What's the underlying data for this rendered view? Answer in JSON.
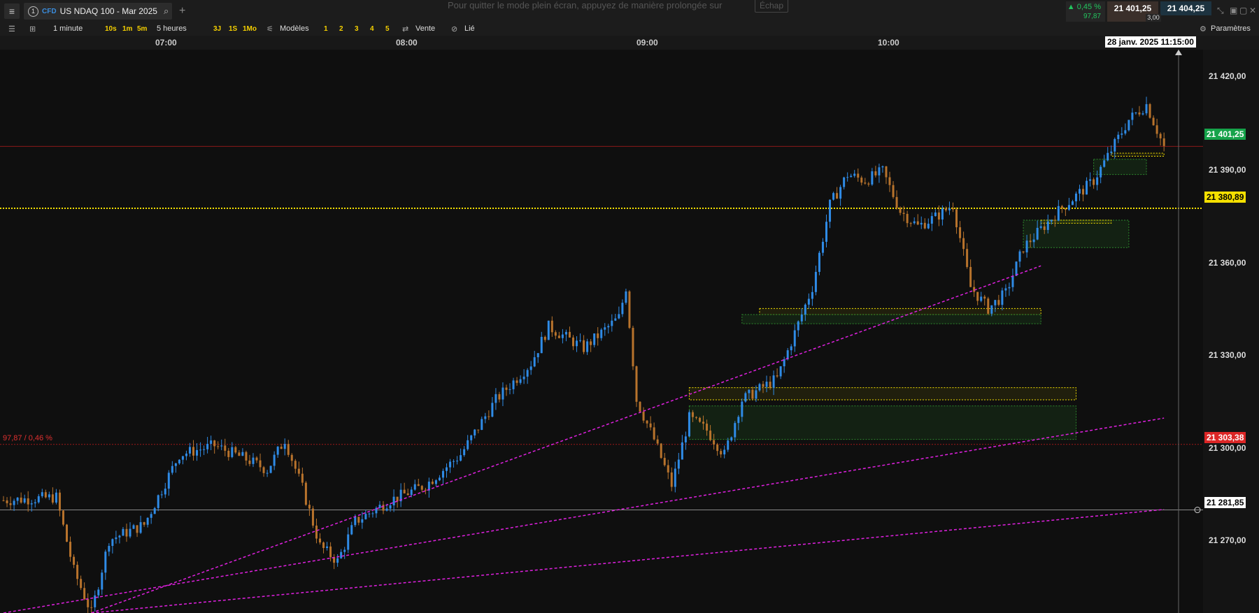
{
  "topbar": {
    "tab_number": "1",
    "tab_type": "CFD",
    "tab_title": "US NDAQ 100 - Mar 2025",
    "fullscreen_msg": "Pour quitter le mode plein écran, appuyez de manière prolongée sur",
    "fullscreen_key": "Échap",
    "change_pct": "▲ 0,45 %",
    "change_val": "97,87",
    "bid": "21 401,25",
    "ask": "21 404,25",
    "spread": "3,00",
    "icons": [
      "menu-icon",
      "search-icon",
      "plus-icon",
      "minimize-icon",
      "restore-icon",
      "maximize-icon",
      "close-icon"
    ]
  },
  "toolbar": {
    "interval": "1 minute",
    "quick_intervals": [
      "10s",
      "1m",
      "5m"
    ],
    "range": "5 heures",
    "quick_ranges": [
      "3J",
      "1S",
      "1Mo"
    ],
    "templates": "Modèles",
    "template_slots": [
      "1",
      "2",
      "3",
      "4",
      "5"
    ],
    "sell": "Vente",
    "linked": "Lié",
    "settings": "Paramètres"
  },
  "time_axis": {
    "labels": [
      "07:00",
      "08:00",
      "09:00",
      "10:00"
    ],
    "cursor_date": "28 janv. 2025 11:15:00"
  },
  "price_axis": {
    "ticks": [
      "21 420,00",
      "21 390,00",
      "21 360,00",
      "21 330,00",
      "21 300,00",
      "21 270,00"
    ],
    "last_price": "21 401,25",
    "alert_line": "21 380,89",
    "ref_price": "21 303,38",
    "crosshair_price": "21 281,85"
  },
  "change_label": "97,87 / 0,46 %",
  "colors": {
    "up_candle": "#2f8be6",
    "down_candle": "#b8732c",
    "trendline": "#e020e0",
    "alert_yellow": "#f5e000",
    "zone_green": "#2e8b2e",
    "last_price_bg": "#16a34a",
    "ref_price_bg": "#dc2626"
  },
  "chart_data": {
    "type": "candlestick",
    "instrument": "US NDAQ 100 - Mar 2025",
    "interval": "1 minute",
    "x_range": [
      "06:40",
      "11:15"
    ],
    "ylim": [
      21248,
      21433
    ],
    "close_path": [
      [
        "06:40",
        21285
      ],
      [
        "06:55",
        21286
      ],
      [
        "07:00",
        21262
      ],
      [
        "07:05",
        21248
      ],
      [
        "07:10",
        21272
      ],
      [
        "07:20",
        21277
      ],
      [
        "07:30",
        21300
      ],
      [
        "07:40",
        21303
      ],
      [
        "07:50",
        21298
      ],
      [
        "07:55",
        21295
      ],
      [
        "08:00",
        21305
      ],
      [
        "08:05",
        21289
      ],
      [
        "08:10",
        21270
      ],
      [
        "08:15",
        21265
      ],
      [
        "08:20",
        21278
      ],
      [
        "08:30",
        21285
      ],
      [
        "08:40",
        21290
      ],
      [
        "08:50",
        21300
      ],
      [
        "09:00",
        21318
      ],
      [
        "09:10",
        21330
      ],
      [
        "09:15",
        21342
      ],
      [
        "09:25",
        21335
      ],
      [
        "09:35",
        21345
      ],
      [
        "09:37",
        21355
      ],
      [
        "09:40",
        21318
      ],
      [
        "09:45",
        21305
      ],
      [
        "09:50",
        21290
      ],
      [
        "09:55",
        21312
      ],
      [
        "10:00",
        21308
      ],
      [
        "10:05",
        21300
      ],
      [
        "10:10",
        21318
      ],
      [
        "10:20",
        21325
      ],
      [
        "10:25",
        21340
      ],
      [
        "10:30",
        21355
      ],
      [
        "10:35",
        21382
      ],
      [
        "10:40",
        21392
      ],
      [
        "10:45",
        21390
      ],
      [
        "10:50",
        21393
      ],
      [
        "10:55",
        21380
      ],
      [
        "11:00",
        21375
      ],
      [
        "11:05",
        21378
      ],
      [
        "11:10",
        21382
      ],
      [
        "11:15",
        21355
      ],
      [
        "11:20",
        21348
      ],
      [
        "11:25",
        21353
      ],
      [
        "11:30",
        21368
      ],
      [
        "11:35",
        21374
      ],
      [
        "11:40",
        21380
      ],
      [
        "11:45",
        21385
      ],
      [
        "11:50",
        21390
      ],
      [
        "11:55",
        21400
      ],
      [
        "12:00",
        21410
      ],
      [
        "12:05",
        21415
      ],
      [
        "12:10",
        21401
      ]
    ],
    "horizontal_lines": [
      {
        "name": "last-price",
        "y": 21401.25
      },
      {
        "name": "alert",
        "y": 21380.89
      },
      {
        "name": "reference",
        "y": 21303.38
      },
      {
        "name": "crosshair",
        "y": 21281.85
      }
    ],
    "trendlines": [
      {
        "from": [
          "07:05",
          21248
        ],
        "to": [
          "11:35",
          21362
        ]
      },
      {
        "from": [
          "06:40",
          21248
        ],
        "to": [
          "12:10",
          21312
        ]
      },
      {
        "from": [
          "07:05",
          21248
        ],
        "to": [
          "12:10",
          21282
        ]
      }
    ],
    "zones": [
      {
        "type": "yellow",
        "x": [
          "09:55",
          "11:45"
        ],
        "y": [
          21318,
          21322
        ]
      },
      {
        "type": "green",
        "x": [
          "09:55",
          "11:45"
        ],
        "y": [
          21305,
          21316
        ]
      },
      {
        "type": "yellow",
        "x": [
          "10:15",
          "11:35"
        ],
        "y": [
          21346,
          21348
        ]
      },
      {
        "type": "green",
        "x": [
          "10:10",
          "11:35"
        ],
        "y": [
          21343,
          21346
        ]
      },
      {
        "type": "green",
        "x": [
          "11:30",
          "12:00"
        ],
        "y": [
          21368,
          21377
        ]
      },
      {
        "type": "yellow",
        "x": [
          "11:35",
          "11:55"
        ],
        "y": [
          21376,
          21377
        ]
      },
      {
        "type": "green",
        "x": [
          "11:50",
          "12:05"
        ],
        "y": [
          21392,
          21397
        ]
      },
      {
        "type": "yellow",
        "x": [
          "11:55",
          "12:10"
        ],
        "y": [
          21398,
          21399
        ]
      }
    ]
  }
}
